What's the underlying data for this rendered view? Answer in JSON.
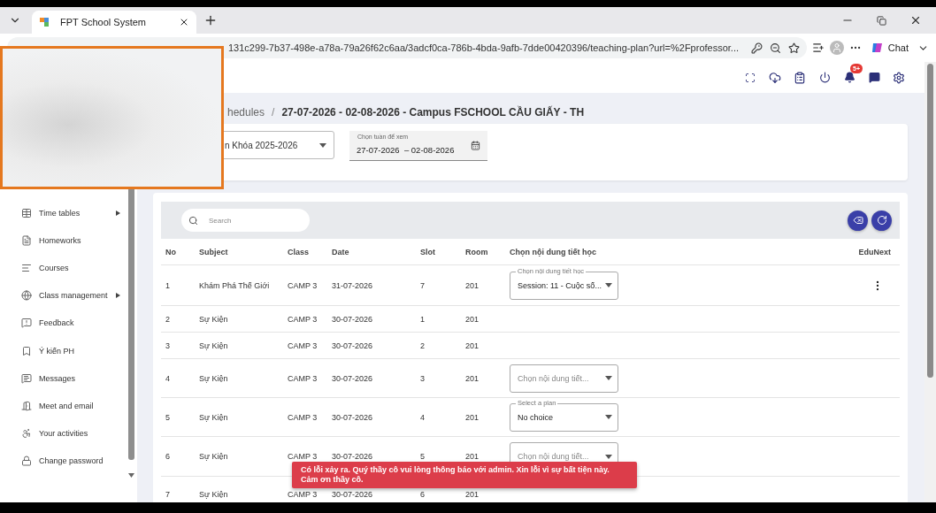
{
  "browser": {
    "tab_title": "FPT School System",
    "url": "131c299-7b37-498e-a78a-79a26f62c6aa/3adcf0ca-786b-4bda-9afb-7dde00420396/teaching-plan?url=%2Fprofessor...",
    "chat_label": "Chat"
  },
  "app_header": {
    "notification_badge": "5+"
  },
  "breadcrumb": {
    "parent": "hedules",
    "separator": "/",
    "current": "27-07-2026 - 02-08-2026 - Campus FSCHOOL CẦU GIẤY - TH"
  },
  "filters": {
    "course_select": {
      "value": "n Khóa 2025-2026"
    },
    "week_picker": {
      "label": "Chọn tuần để xem",
      "start": "27-07-2026",
      "separator": "–",
      "end": "02-08-2026"
    }
  },
  "sidebar": {
    "items": [
      {
        "label": "Time tables",
        "expandable": true
      },
      {
        "label": "Homeworks",
        "expandable": false
      },
      {
        "label": "Courses",
        "expandable": false
      },
      {
        "label": "Class management",
        "expandable": true
      },
      {
        "label": "Feedback",
        "expandable": false
      },
      {
        "label": "Ý kiến PH",
        "expandable": false
      },
      {
        "label": "Messages",
        "expandable": false
      },
      {
        "label": "Meet and email",
        "expandable": false
      },
      {
        "label": "Your activities",
        "expandable": false
      },
      {
        "label": "Change password",
        "expandable": false
      }
    ]
  },
  "table": {
    "search": {
      "placeholder": "Search"
    },
    "columns": [
      "No",
      "Subject",
      "Class",
      "Date",
      "Slot",
      "Room",
      "Chọn nội dung tiết học",
      "EduNext"
    ],
    "rows": [
      {
        "cells": [
          "1",
          "Khám Phá Thế Giới",
          "CAMP 3",
          "31-07-2026",
          "7",
          "201"
        ],
        "plan": {
          "kind": "select",
          "label": "Chọn nội dung tiết học",
          "value": "Session: 11 - Cuộc số..."
        },
        "has_menu": true
      },
      {
        "cells": [
          "2",
          "Sự Kiện",
          "CAMP 3",
          "30-07-2026",
          "1",
          "201"
        ],
        "has_menu": false
      },
      {
        "cells": [
          "3",
          "Sự Kiện",
          "CAMP 3",
          "30-07-2026",
          "2",
          "201"
        ],
        "has_menu": false
      },
      {
        "cells": [
          "4",
          "Sự Kiện",
          "CAMP 3",
          "30-07-2026",
          "3",
          "201"
        ],
        "plan": {
          "kind": "select",
          "placeholder": "Chọn nội dung tiết..."
        },
        "has_menu": false
      },
      {
        "cells": [
          "5",
          "Sự Kiện",
          "CAMP 3",
          "30-07-2026",
          "4",
          "201"
        ],
        "plan": {
          "kind": "select",
          "label": "Select a plan",
          "value": "No choice"
        },
        "has_menu": false
      },
      {
        "cells": [
          "6",
          "Sự Kiện",
          "CAMP 3",
          "30-07-2026",
          "5",
          "201"
        ],
        "plan": {
          "kind": "select",
          "placeholder": "Chọn nội dung tiết..."
        },
        "has_menu": false
      },
      {
        "cells": [
          "7",
          "Sự Kiện",
          "CAMP 3",
          "30-07-2026",
          "6",
          "201"
        ],
        "has_menu": false
      }
    ]
  },
  "toast": {
    "message": "Có lỗi xảy ra. Quý thầy cô vui lòng thông báo với admin. Xin lỗi vì sự bất tiện này. Cảm ơn thầy cô."
  }
}
